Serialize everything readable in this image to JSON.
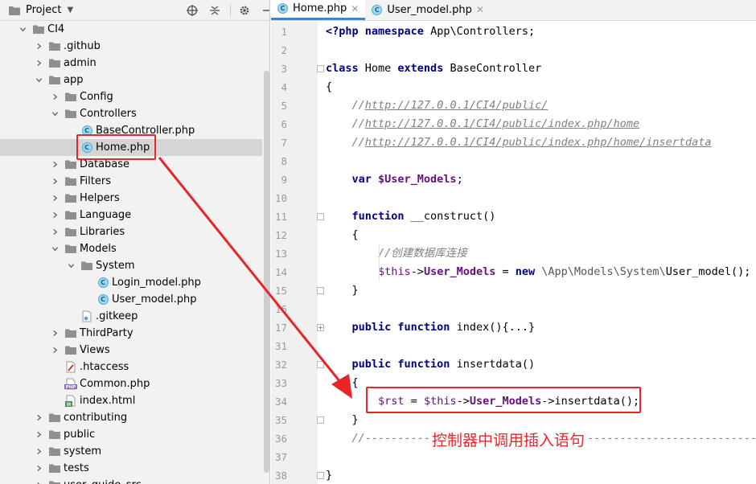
{
  "project_panel": {
    "title": "Project",
    "tools": [
      {
        "name": "locate-icon",
        "glyph": "⊕"
      },
      {
        "name": "collapse-all-icon",
        "glyph": "⇕"
      },
      {
        "name": "settings-icon",
        "glyph": "⚙"
      },
      {
        "name": "hide-icon",
        "glyph": "−"
      }
    ],
    "tree": [
      {
        "label": "CI4",
        "depth": 1,
        "type": "folder",
        "expanded": true
      },
      {
        "label": ".github",
        "depth": 2,
        "type": "folder",
        "expanded": false
      },
      {
        "label": "admin",
        "depth": 2,
        "type": "folder",
        "expanded": false
      },
      {
        "label": "app",
        "depth": 2,
        "type": "folder",
        "expanded": true
      },
      {
        "label": "Config",
        "depth": 3,
        "type": "folder",
        "expanded": false
      },
      {
        "label": "Controllers",
        "depth": 3,
        "type": "folder",
        "expanded": true
      },
      {
        "label": "BaseController.php",
        "depth": 4,
        "type": "class"
      },
      {
        "label": "Home.php",
        "depth": 4,
        "type": "class",
        "selected": true
      },
      {
        "label": "Database",
        "depth": 3,
        "type": "folder",
        "expanded": false
      },
      {
        "label": "Filters",
        "depth": 3,
        "type": "folder",
        "expanded": false
      },
      {
        "label": "Helpers",
        "depth": 3,
        "type": "folder",
        "expanded": false
      },
      {
        "label": "Language",
        "depth": 3,
        "type": "folder",
        "expanded": false
      },
      {
        "label": "Libraries",
        "depth": 3,
        "type": "folder",
        "expanded": false
      },
      {
        "label": "Models",
        "depth": 3,
        "type": "folder",
        "expanded": true
      },
      {
        "label": "System",
        "depth": 4,
        "type": "folder",
        "expanded": true
      },
      {
        "label": "Login_model.php",
        "depth": 5,
        "type": "class"
      },
      {
        "label": "User_model.php",
        "depth": 5,
        "type": "class"
      },
      {
        "label": ".gitkeep",
        "depth": 4,
        "type": "gitkeep"
      },
      {
        "label": "ThirdParty",
        "depth": 3,
        "type": "folder",
        "expanded": false
      },
      {
        "label": "Views",
        "depth": 3,
        "type": "folder",
        "expanded": false
      },
      {
        "label": ".htaccess",
        "depth": 3,
        "type": "htaccess"
      },
      {
        "label": "Common.php",
        "depth": 3,
        "type": "php"
      },
      {
        "label": "index.html",
        "depth": 3,
        "type": "html"
      },
      {
        "label": "contributing",
        "depth": 2,
        "type": "folder",
        "expanded": false
      },
      {
        "label": "public",
        "depth": 2,
        "type": "folder",
        "expanded": false
      },
      {
        "label": "system",
        "depth": 2,
        "type": "folder",
        "expanded": false
      },
      {
        "label": "tests",
        "depth": 2,
        "type": "folder",
        "expanded": false
      },
      {
        "label": "user_guide_src",
        "depth": 2,
        "type": "folder",
        "expanded": false
      }
    ]
  },
  "tabs": [
    {
      "label": "Home.php",
      "active": true
    },
    {
      "label": "User_model.php",
      "active": false
    }
  ],
  "code": [
    {
      "n": "1",
      "parts": [
        [
          "kw",
          "<?php "
        ],
        [
          "kw",
          "namespace "
        ],
        [
          "cls",
          "App\\Controllers;"
        ]
      ]
    },
    {
      "n": "2",
      "parts": []
    },
    {
      "n": "3",
      "fold": "box",
      "parts": [
        [
          "kw",
          "class "
        ],
        [
          "cls",
          "Home "
        ],
        [
          "kw",
          "extends "
        ],
        [
          "cls",
          "BaseController"
        ]
      ]
    },
    {
      "n": "4",
      "parts": [
        [
          "cls",
          "{"
        ]
      ]
    },
    {
      "n": "5",
      "parts": [
        [
          "cmt",
          "    //"
        ],
        [
          "link",
          "http://127.0.0.1/CI4/public/"
        ]
      ]
    },
    {
      "n": "6",
      "parts": [
        [
          "cmt",
          "    //"
        ],
        [
          "link",
          "http://127.0.0.1/CI4/public/index.php/home"
        ]
      ]
    },
    {
      "n": "7",
      "parts": [
        [
          "cmt",
          "    //"
        ],
        [
          "link",
          "http://127.0.0.1/CI4/public/index.php/home/insertdata"
        ]
      ]
    },
    {
      "n": "8",
      "parts": []
    },
    {
      "n": "9",
      "parts": [
        [
          "cls",
          "    "
        ],
        [
          "kw",
          "var "
        ],
        [
          "var-b",
          "$User_Models"
        ],
        [
          "cls",
          ";"
        ]
      ]
    },
    {
      "n": "10",
      "parts": []
    },
    {
      "n": "11",
      "fold": "box",
      "parts": [
        [
          "cls",
          "    "
        ],
        [
          "kw",
          "function "
        ],
        [
          "cls",
          "__construct()"
        ]
      ]
    },
    {
      "n": "12",
      "parts": [
        [
          "cls",
          "    {"
        ]
      ]
    },
    {
      "n": "13",
      "parts": [
        [
          "cmt",
          "        //创建数据库连接"
        ]
      ]
    },
    {
      "n": "14",
      "parts": [
        [
          "cls",
          "        "
        ],
        [
          "var",
          "$this"
        ],
        [
          "cls",
          "->"
        ],
        [
          "var-b",
          "User_Models"
        ],
        [
          "cls",
          " = "
        ],
        [
          "kw",
          "new "
        ],
        [
          "ns",
          "\\App\\Models\\System\\"
        ],
        [
          "cls",
          "User_model();"
        ]
      ]
    },
    {
      "n": "15",
      "fold": "end",
      "parts": [
        [
          "cls",
          "    }"
        ]
      ]
    },
    {
      "n": "16",
      "parts": []
    },
    {
      "n": "17",
      "fold": "plus",
      "parts": [
        [
          "cls",
          "    "
        ],
        [
          "kw",
          "public function "
        ],
        [
          "cls",
          "index(){...}"
        ]
      ]
    },
    {
      "n": "31",
      "parts": []
    },
    {
      "n": "32",
      "fold": "box",
      "parts": [
        [
          "cls",
          "    "
        ],
        [
          "kw",
          "public function "
        ],
        [
          "cls",
          "insertdata()"
        ]
      ]
    },
    {
      "n": "33",
      "parts": [
        [
          "cls",
          "    {"
        ]
      ]
    },
    {
      "n": "34",
      "parts": [
        [
          "cls",
          "        "
        ],
        [
          "var",
          "$rst"
        ],
        [
          "cls",
          " = "
        ],
        [
          "var",
          "$this"
        ],
        [
          "cls",
          "->"
        ],
        [
          "var-b",
          "User_Models"
        ],
        [
          "cls",
          "->insertdata();"
        ]
      ]
    },
    {
      "n": "35",
      "fold": "end",
      "parts": [
        [
          "cls",
          "    }"
        ]
      ]
    },
    {
      "n": "36",
      "parts": [
        [
          "cmt",
          "    //-----------------------------------------------------------------"
        ]
      ]
    },
    {
      "n": "37",
      "parts": []
    },
    {
      "n": "38",
      "fold": "end",
      "parts": [
        [
          "cls",
          "}"
        ]
      ]
    }
  ],
  "annotation": {
    "text": "控制器中调用插入语句"
  },
  "colors": {
    "annotation_red": "#e8262a",
    "tab_accent": "#4083c9",
    "keyword": "#000080",
    "field": "#660e7a",
    "comment": "#808080"
  }
}
